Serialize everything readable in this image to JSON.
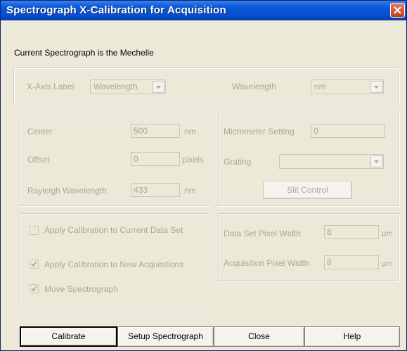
{
  "window": {
    "title": "Spectrograph X-Calibration for Acquisition",
    "close_icon": "close-icon"
  },
  "info": {
    "current_spectrograph": "Current Spectrograph is the Mechelle"
  },
  "axis": {
    "x_axis_label": "X-Axis Label",
    "x_axis_value": "Wavelength",
    "wavelength_label": "Wavelength",
    "wavelength_unit": "nm"
  },
  "center_group": {
    "center_label": "Center",
    "center_value": "500",
    "center_unit": "nm",
    "offset_label": "Offset",
    "offset_value": "0",
    "offset_unit": "pixels",
    "rayleigh_label": "Rayleigh Wavelength",
    "rayleigh_value": "433",
    "rayleigh_unit": "nm"
  },
  "micrometer_group": {
    "micrometer_label": "Micrometer Setting",
    "micrometer_value": "0",
    "grating_label": "Grating",
    "grating_value": "",
    "slit_button": "Slit Control"
  },
  "options_group": {
    "apply_current": {
      "label": "Apply Calibration to Current Data Set",
      "checked": false
    },
    "apply_new": {
      "label": "Apply Calibration to New Acquisitions",
      "checked": true
    },
    "move_spectrograph": {
      "label": "Move Spectrograph",
      "checked": true
    }
  },
  "pixel_group": {
    "data_set_label": "Data Set Pixel Width",
    "data_set_value": "8",
    "data_set_unit_icon": "micrometer-unit-icon",
    "acquisition_label": "Acquisition Pixel Width",
    "acquisition_value": "8",
    "acquisition_unit_icon": "micrometer-unit-icon"
  },
  "buttons": {
    "calibrate": "Calibrate",
    "setup": "Setup Spectrograph",
    "close": "Close",
    "help": "Help"
  },
  "colors": {
    "title_bar": "#0a5ad8",
    "dialog_bg": "#ece9d8",
    "disabled_text": "#aca899",
    "close_button": "#c23c1a"
  }
}
